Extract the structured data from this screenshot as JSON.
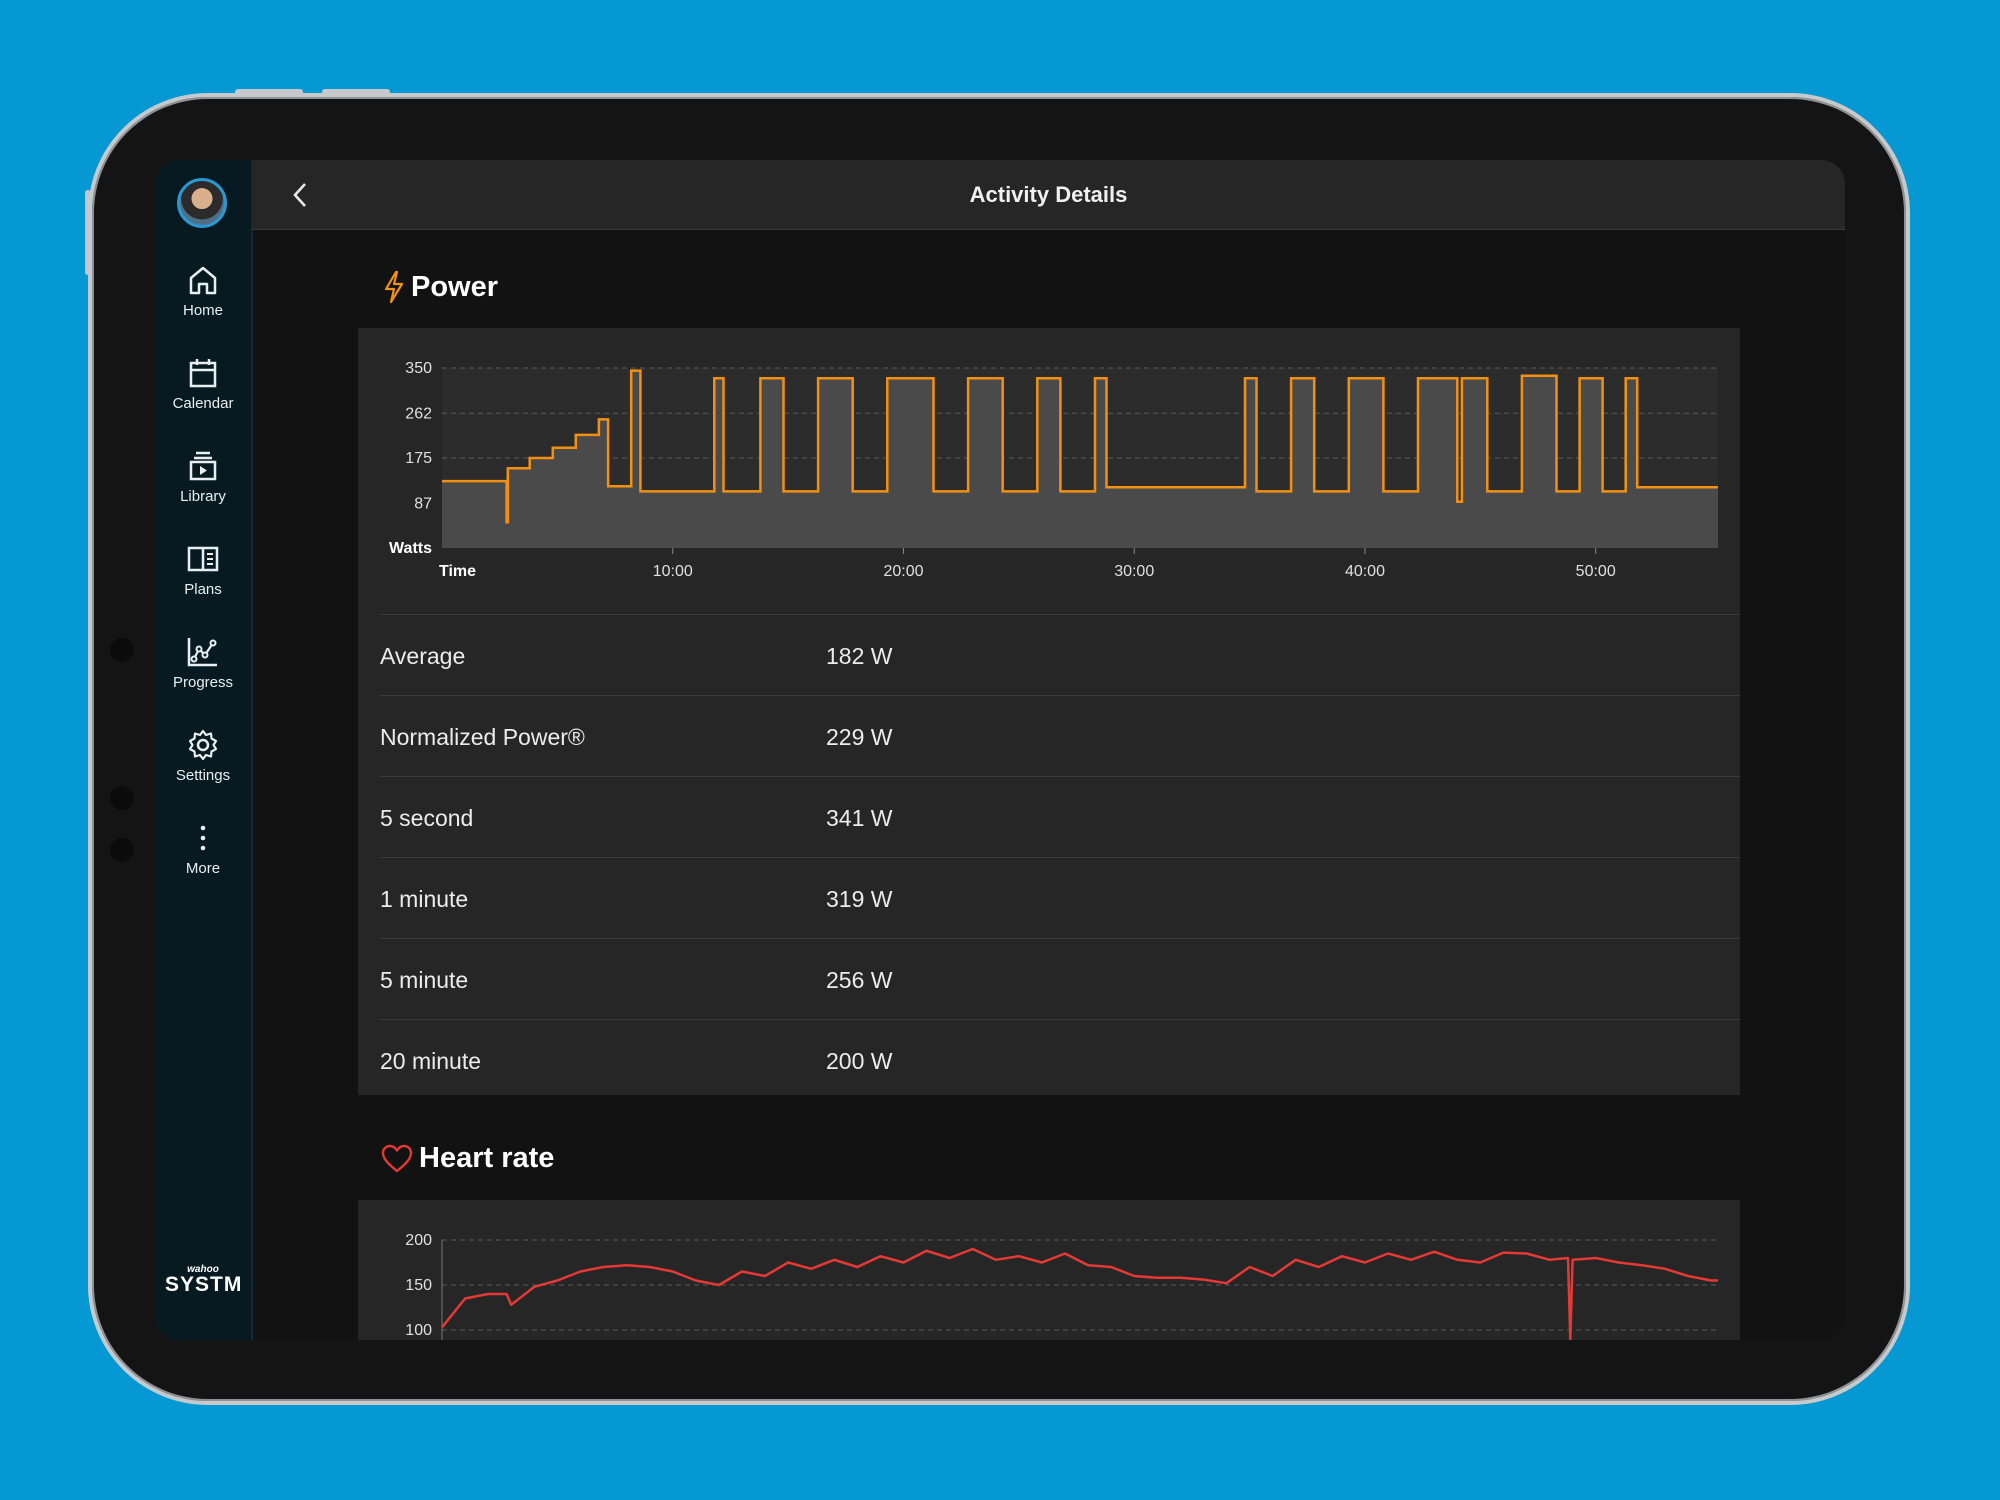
{
  "app": {
    "title": "Activity Details",
    "logo_small": "wahoo",
    "logo_big": "SYSTM"
  },
  "sidebar": {
    "items": [
      {
        "label": "Home",
        "icon": "home-icon"
      },
      {
        "label": "Calendar",
        "icon": "calendar-icon"
      },
      {
        "label": "Library",
        "icon": "library-icon"
      },
      {
        "label": "Plans",
        "icon": "plans-icon"
      },
      {
        "label": "Progress",
        "icon": "progress-icon"
      },
      {
        "label": "Settings",
        "icon": "gear-icon"
      },
      {
        "label": "More",
        "icon": "more-icon"
      }
    ]
  },
  "power": {
    "title": "Power",
    "icon": "lightning-icon",
    "stats": [
      {
        "label": "Average",
        "value": "182 W"
      },
      {
        "label": "Normalized Power®",
        "value": "229 W"
      },
      {
        "label": "5 second",
        "value": "341 W"
      },
      {
        "label": "1 minute",
        "value": "319 W"
      },
      {
        "label": "5 minute",
        "value": "256 W"
      },
      {
        "label": "20 minute",
        "value": "200 W"
      }
    ]
  },
  "heart_rate": {
    "title": "Heart rate",
    "icon": "heart-icon"
  },
  "colors": {
    "power_line": "#f29111",
    "heart_line": "#e53935",
    "accent": "#2b97d3"
  },
  "chart_data": [
    {
      "type": "area",
      "title": "",
      "ylabel": "Watts",
      "xlabel": "Time",
      "yticks": [
        350,
        262,
        175,
        87
      ],
      "xticks": [
        "10:00",
        "20:00",
        "30:00",
        "40:00",
        "50:00"
      ],
      "xlim": [
        0,
        55.3
      ],
      "ylim": [
        0,
        350
      ],
      "grid": true,
      "series": [
        {
          "x": [
            0,
            2.8,
            2.8,
            2.85,
            2.85,
            3.8,
            3.8,
            4.8,
            4.8,
            5.8,
            5.8,
            6.8,
            6.8,
            7.2,
            7.2,
            8.2,
            8.2,
            8.6,
            8.6,
            11.8,
            11.8,
            12.2,
            12.2,
            13.8,
            13.8,
            14.8,
            14.8,
            16.3,
            16.3,
            17.8,
            17.8,
            19.3,
            19.3,
            21.3,
            21.3,
            22.8,
            22.8,
            24.3,
            24.3,
            25.8,
            25.8,
            26.8,
            26.8,
            28.3,
            28.3,
            28.8,
            28.8,
            34.8,
            34.8,
            35.3,
            35.3,
            36.8,
            36.8,
            37.8,
            37.8,
            39.3,
            39.3,
            40.8,
            40.8,
            42.3,
            42.3,
            44.0,
            44.0,
            44.2,
            44.2,
            45.3,
            45.3,
            46.8,
            46.8,
            48.3,
            48.3,
            49.3,
            49.3,
            50.3,
            50.3,
            51.3,
            51.3,
            51.8,
            51.8,
            55.3
          ],
          "y": [
            130,
            130,
            50,
            50,
            155,
            155,
            175,
            175,
            195,
            195,
            220,
            220,
            250,
            250,
            120,
            120,
            345,
            345,
            110,
            110,
            330,
            330,
            110,
            110,
            330,
            330,
            110,
            110,
            330,
            330,
            110,
            110,
            330,
            330,
            110,
            110,
            330,
            330,
            110,
            110,
            330,
            330,
            110,
            110,
            330,
            330,
            118,
            118,
            330,
            330,
            110,
            110,
            330,
            330,
            110,
            110,
            330,
            330,
            110,
            110,
            330,
            330,
            90,
            90,
            330,
            330,
            110,
            110,
            335,
            335,
            110,
            110,
            330,
            330,
            110,
            110,
            330,
            330,
            118,
            118
          ]
        }
      ]
    },
    {
      "type": "line",
      "title": "",
      "yticks": [
        200,
        150,
        100
      ],
      "xlim": [
        0,
        55.3
      ],
      "ylim": [
        100,
        200
      ],
      "grid": true,
      "series": [
        {
          "x": [
            0,
            1,
            2,
            2.8,
            3,
            4,
            5,
            6,
            7,
            8,
            9,
            10,
            11,
            12,
            13,
            14,
            15,
            16,
            17,
            18,
            19,
            20,
            21,
            22,
            23,
            24,
            25,
            26,
            27,
            28,
            29,
            30,
            31,
            32,
            33,
            34,
            35,
            36,
            37,
            38,
            39,
            40,
            41,
            42,
            43,
            44,
            45,
            46,
            47,
            48,
            48.8,
            48.9,
            49,
            50,
            51,
            52,
            53,
            54,
            55,
            55.3
          ],
          "y": [
            103,
            135,
            140,
            140,
            128,
            148,
            155,
            165,
            170,
            172,
            170,
            165,
            155,
            150,
            165,
            160,
            175,
            168,
            178,
            170,
            182,
            175,
            188,
            180,
            190,
            178,
            182,
            175,
            185,
            172,
            170,
            160,
            158,
            158,
            156,
            152,
            170,
            160,
            178,
            170,
            182,
            175,
            185,
            178,
            187,
            178,
            175,
            186,
            185,
            178,
            180,
            90,
            178,
            180,
            175,
            172,
            168,
            160,
            155,
            155
          ]
        }
      ]
    }
  ]
}
